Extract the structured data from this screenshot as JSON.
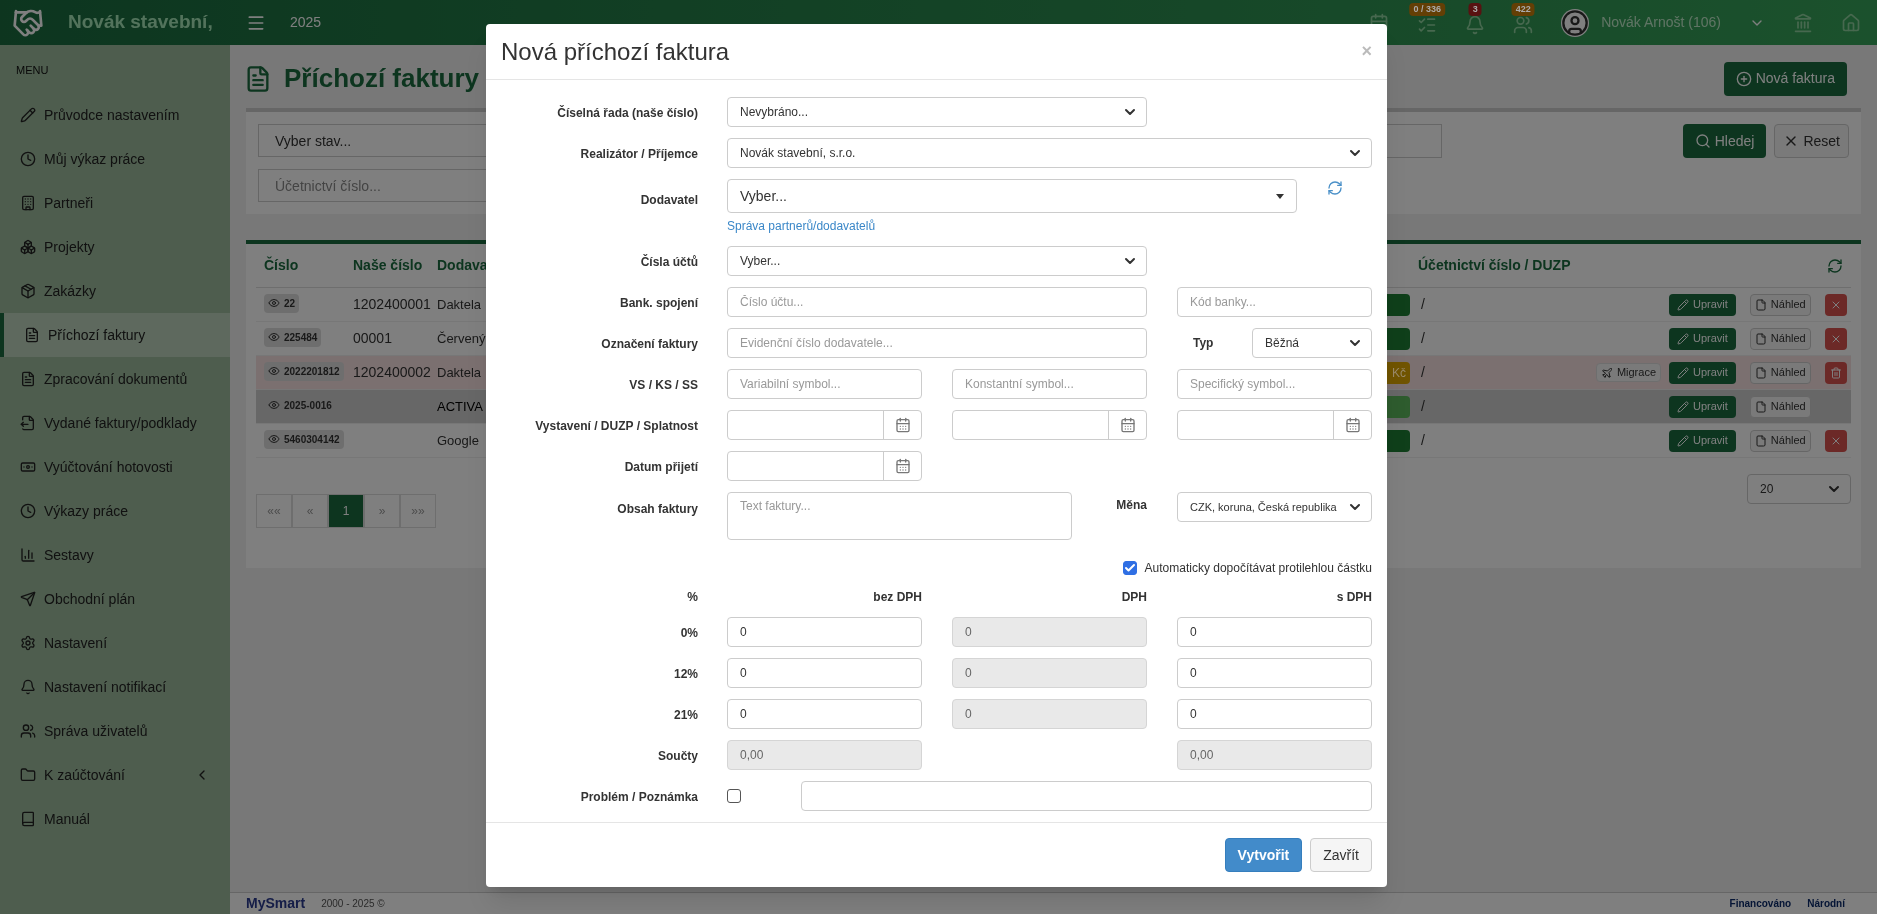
{
  "topbar": {
    "brand": "Novák stavební,",
    "year": "2025",
    "badges": [
      {
        "count": "0 / 336",
        "color": "#643f05"
      },
      {
        "count": "3",
        "color": "#591111"
      },
      {
        "count": "422",
        "color": "#643f05"
      }
    ],
    "user": "Novák Arnošt (106)"
  },
  "sidebar": {
    "heading": "MENU",
    "items": [
      {
        "label": "Průvodce nastavením",
        "selected": false,
        "expandable": false
      },
      {
        "label": "Můj výkaz práce",
        "selected": false,
        "expandable": false
      },
      {
        "label": "Partneři",
        "selected": false,
        "expandable": false
      },
      {
        "label": "Projekty",
        "selected": false,
        "expandable": false
      },
      {
        "label": "Zakázky",
        "selected": false,
        "expandable": false
      },
      {
        "label": "Příchozí faktury",
        "selected": true,
        "expandable": false
      },
      {
        "label": "Zpracování dokumentů",
        "selected": false,
        "expandable": false
      },
      {
        "label": "Vydané faktury/podklady",
        "selected": false,
        "expandable": false
      },
      {
        "label": "Vyúčtování hotovosti",
        "selected": false,
        "expandable": false
      },
      {
        "label": "Výkazy práce",
        "selected": false,
        "expandable": false
      },
      {
        "label": "Sestavy",
        "selected": false,
        "expandable": false
      },
      {
        "label": "Obchodní plán",
        "selected": false,
        "expandable": false
      },
      {
        "label": "Nastavení",
        "selected": false,
        "expandable": false
      },
      {
        "label": "Nastavení notifikací",
        "selected": false,
        "expandable": false
      },
      {
        "label": "Správa uživatelů",
        "selected": false,
        "expandable": false
      },
      {
        "label": "K zaúčtování",
        "selected": false,
        "expandable": true
      },
      {
        "label": "Manuál",
        "selected": false,
        "expandable": false
      }
    ]
  },
  "page": {
    "title": "Příchozí faktury",
    "new_button": "Nová faktura",
    "filters": {
      "state_placeholder": "Vyber stav...",
      "number_placeholder": "Účetnictví číslo...",
      "search_button": "Hledej",
      "reset_button": "Reset"
    },
    "table": {
      "columns": [
        "Číslo",
        "Naše číslo",
        "Dodava",
        "Účetnictví číslo / DUZP"
      ],
      "rows": [
        {
          "number": "22",
          "our_number": "1202400001",
          "supplier": "Daktela",
          "color": "#0f3f1a",
          "accounting": "/",
          "kind": "normal",
          "edit": "Upravit",
          "preview": "Náhled",
          "delete": {
            "kind": "cross"
          }
        },
        {
          "number": "225484",
          "our_number": "00001",
          "supplier": "Červený",
          "color": "#0f3f1a",
          "accounting": "/",
          "kind": "normal",
          "edit": "Upravit",
          "preview": "Náhled",
          "delete": {
            "kind": "cross"
          }
        },
        {
          "number": "2022201812",
          "our_number": "1202400002",
          "supplier": "Daktela",
          "status": "Kč",
          "color": "#705400",
          "accounting": "/",
          "kind": "warning",
          "migrate": "Migrace",
          "edit": "Upravit",
          "preview": "Náhled",
          "delete": {
            "kind": "trash"
          }
        },
        {
          "number": "2025-0016",
          "supplier": "ACTIVA",
          "color": "#2e5c2e",
          "accounting": "/",
          "kind": "active",
          "edit": "Upravit",
          "preview": "Náhled"
        },
        {
          "number": "5460304142",
          "supplier": "Google",
          "color": "#0f3f1a",
          "accounting": "/",
          "kind": "normal",
          "edit": "Upravit",
          "preview": "Náhled",
          "delete": {
            "kind": "cross"
          }
        }
      ]
    },
    "pagination": [
      {
        "label": "««",
        "selected": false
      },
      {
        "label": "«",
        "selected": false
      },
      {
        "label": "1",
        "selected": true
      },
      {
        "label": "»",
        "selected": false
      },
      {
        "label": "»»",
        "selected": false
      }
    ],
    "page_size": "20"
  },
  "footer": {
    "logo": "MySmart",
    "copyright": "2000 - 2025 ©",
    "eu": "Financováno",
    "national": "Národní"
  },
  "modal": {
    "title": "Nová příchozí faktura",
    "close": "×",
    "number_series": {
      "label": "Číselná řada (naše číslo)",
      "value": "Nevybráno..."
    },
    "recipient": {
      "label": "Realizátor / Příjemce",
      "value": "Novák stavební, s.r.o."
    },
    "supplier": {
      "label": "Dodavatel",
      "value": "Vyber...",
      "link": "Správa partnerů/dodavatelů"
    },
    "accounts": {
      "label": "Čísla účtů",
      "value": "Vyber..."
    },
    "bank": {
      "label": "Bank. spojení",
      "account_placeholder": "Číslo účtu...",
      "code_placeholder": "Kód banky..."
    },
    "invoice_mark": {
      "label": "Označení faktury",
      "placeholder": "Evidenční číslo dodavatele...",
      "type_label": "Typ",
      "type_value": "Běžná"
    },
    "symbols": {
      "label": "VS / KS / SS",
      "fields": [
        {
          "placeholder": "Variabilní symbol..."
        },
        {
          "placeholder": "Konstantní symbol..."
        },
        {
          "placeholder": "Specifický symbol..."
        }
      ]
    },
    "dates": {
      "label": "Vystavení / DUZP / Splatnost",
      "fields": [
        {
          "kind": "date"
        },
        {
          "kind": "date"
        },
        {
          "kind": "date"
        }
      ]
    },
    "received": {
      "label": "Datum přijetí",
      "fields": [
        {
          "kind": "date"
        }
      ]
    },
    "content": {
      "label": "Obsah faktury",
      "placeholder": "Text faktury...",
      "currency_label": "Měna",
      "currency_value": "CZK, koruna, Česká republika"
    },
    "auto_calc": {
      "label": "Automaticky dopočítávat protilehlou částku",
      "checked": true
    },
    "vat": {
      "columns": [
        "%",
        "bez DPH",
        "DPH",
        "s DPH"
      ],
      "rows": [
        {
          "rate": "0%",
          "cells": [
            {
              "value": "0",
              "disabled": false
            },
            {
              "value": "0",
              "disabled": true
            },
            {
              "value": "0",
              "disabled": false
            }
          ]
        },
        {
          "rate": "12%",
          "cells": [
            {
              "value": "0",
              "disabled": false
            },
            {
              "value": "0",
              "disabled": true
            },
            {
              "value": "0",
              "disabled": false
            }
          ]
        },
        {
          "rate": "21%",
          "cells": [
            {
              "value": "0",
              "disabled": false
            },
            {
              "value": "0",
              "disabled": true
            },
            {
              "value": "0",
              "disabled": false
            }
          ]
        }
      ],
      "totals": {
        "label": "Součty",
        "net": {
          "value": "0,00",
          "disabled": true
        },
        "gross": {
          "value": "0,00",
          "disabled": true
        }
      }
    },
    "problem": {
      "label": "Problém / Poznámka",
      "checked": false
    },
    "buttons": [
      {
        "label": "Vytvořit",
        "kind": "primary"
      },
      {
        "label": "Zavřít",
        "kind": "default"
      }
    ]
  }
}
